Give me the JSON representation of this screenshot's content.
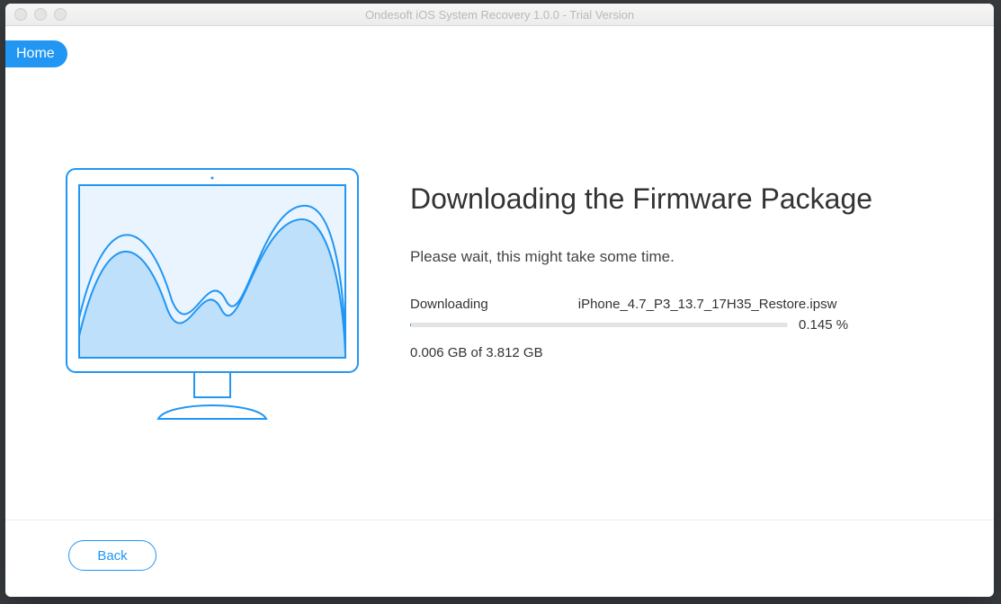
{
  "window": {
    "title": "Ondesoft iOS System Recovery 1.0.0 - Trial Version"
  },
  "nav": {
    "home_label": "Home",
    "back_label": "Back"
  },
  "main": {
    "heading": "Downloading the Firmware Package",
    "subtext": "Please wait, this might take some time.",
    "download_label": "Downloading",
    "filename": "iPhone_4.7_P3_13.7_17H35_Restore.ipsw",
    "percent_text": "0.145 %",
    "percent_value": 0.145,
    "size_text": "0.006 GB of 3.812 GB"
  }
}
